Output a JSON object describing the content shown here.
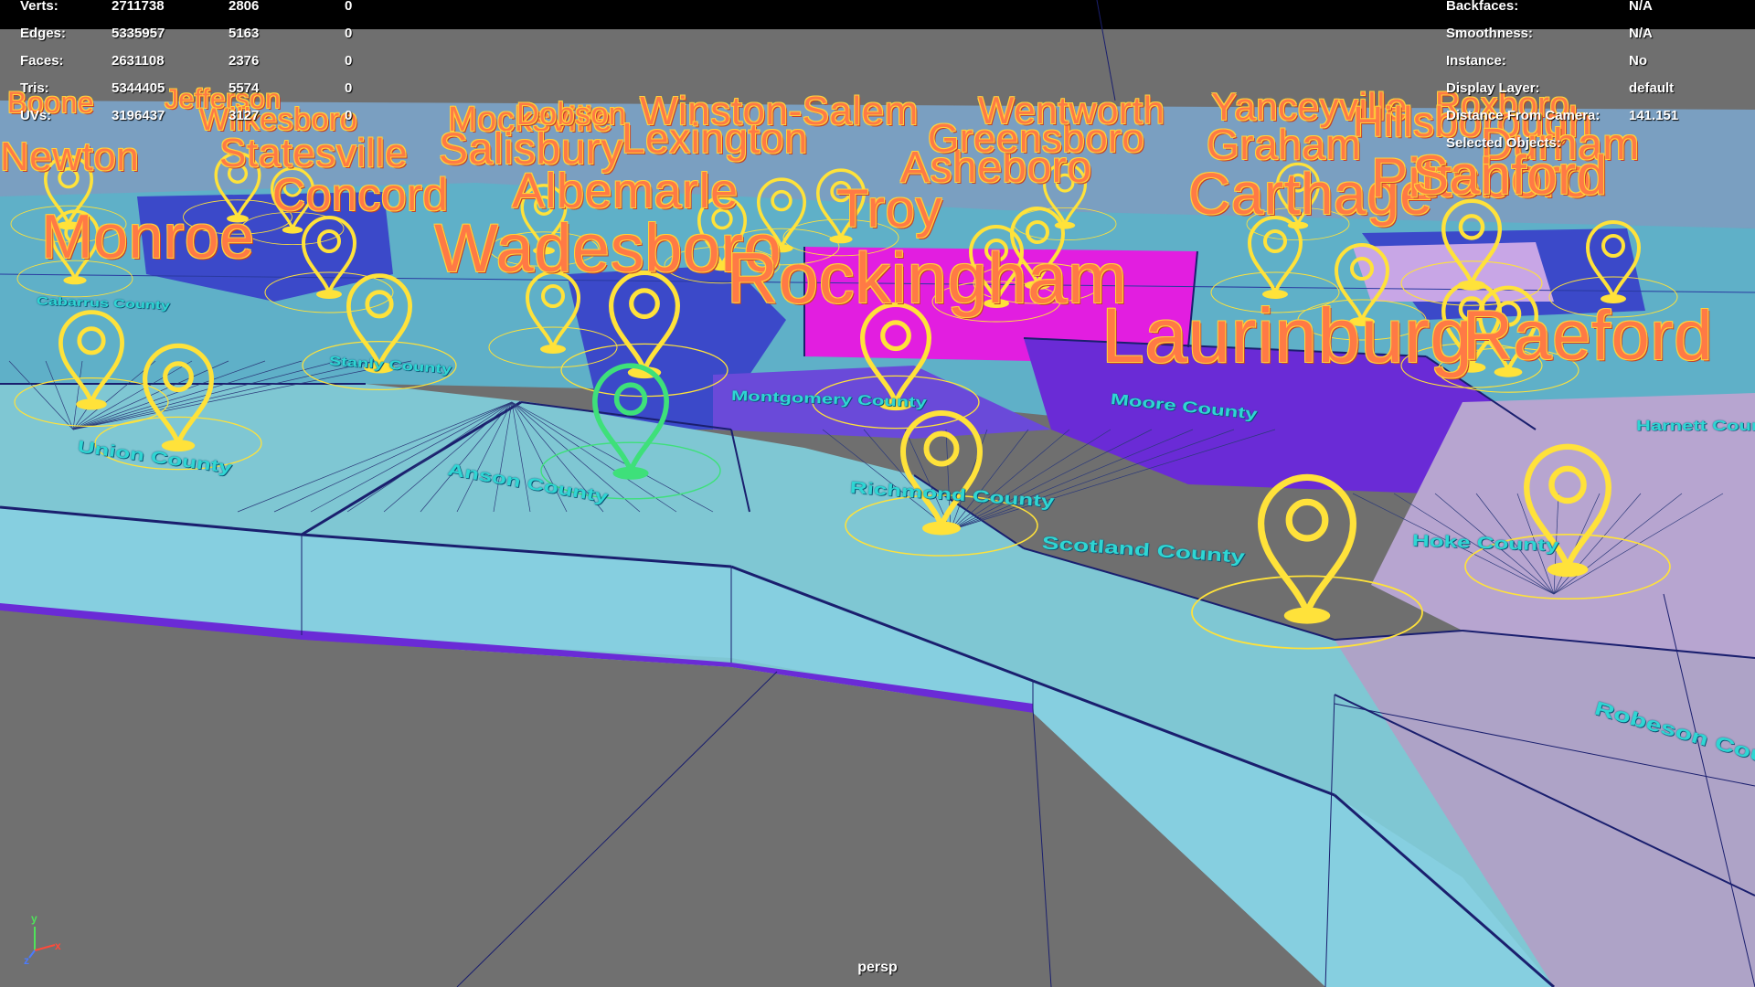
{
  "stats_left": [
    {
      "label": "Verts:",
      "v1": "2711738",
      "v2": "2806",
      "v3": "0"
    },
    {
      "label": "Edges:",
      "v1": "5335957",
      "v2": "5163",
      "v3": "0"
    },
    {
      "label": "Faces:",
      "v1": "2631108",
      "v2": "2376",
      "v3": "0"
    },
    {
      "label": "Tris:",
      "v1": "5344405",
      "v2": "5574",
      "v3": "0"
    },
    {
      "label": "UVs:",
      "v1": "3196437",
      "v2": "3127",
      "v3": "0"
    }
  ],
  "stats_right": [
    {
      "label": "Backfaces:",
      "value": "N/A"
    },
    {
      "label": "Smoothness:",
      "value": "N/A"
    },
    {
      "label": "Instance:",
      "value": "No"
    },
    {
      "label": "Display Layer:",
      "value": "default"
    },
    {
      "label": "Distance From Camera:",
      "value": "141.151"
    },
    {
      "label": "Selected Objects:",
      "value": ""
    }
  ],
  "camera_label": "persp",
  "axes": {
    "y": "y",
    "x": "x",
    "z": "z"
  },
  "cities": [
    {
      "name": "Boone"
    },
    {
      "name": "Jefferson"
    },
    {
      "name": "Wilkesboro"
    },
    {
      "name": "Mocksville"
    },
    {
      "name": "Dobson"
    },
    {
      "name": "Winston-Salem"
    },
    {
      "name": "Lexington"
    },
    {
      "name": "Newton"
    },
    {
      "name": "Statesville"
    },
    {
      "name": "Salisbury"
    },
    {
      "name": "Concord"
    },
    {
      "name": "Albemarle"
    },
    {
      "name": "Monroe"
    },
    {
      "name": "Wadesboro"
    },
    {
      "name": "Troy"
    },
    {
      "name": "Rockingham"
    },
    {
      "name": "Asheboro"
    },
    {
      "name": "Greensboro"
    },
    {
      "name": "Wentworth"
    },
    {
      "name": "Yanceyville"
    },
    {
      "name": "Roxboro"
    },
    {
      "name": "Graham"
    },
    {
      "name": "Hillsborough"
    },
    {
      "name": "Durham"
    },
    {
      "name": "Carthage"
    },
    {
      "name": "Pittsboro"
    },
    {
      "name": "Sanford"
    },
    {
      "name": "Laurinburg"
    },
    {
      "name": "Raeford"
    }
  ],
  "counties": [
    {
      "name": "Union County"
    },
    {
      "name": "Anson County"
    },
    {
      "name": "Richmond County"
    },
    {
      "name": "Montgomery County"
    },
    {
      "name": "Moore County"
    },
    {
      "name": "Scotland County"
    },
    {
      "name": "Hoke County"
    },
    {
      "name": "Robeson County"
    },
    {
      "name": "Stanly County"
    },
    {
      "name": "Cabarrus County"
    },
    {
      "name": "Harnett County"
    }
  ],
  "colors": {
    "background": "#6f6f6f",
    "ground_cyan": "#7fc7d3",
    "wall_cyan": "#86cfe0",
    "magenta": "#e21ee0",
    "purple": "#6a2bd6",
    "blue": "#3b49c9",
    "edge_dark": "#1a1f6e",
    "marker": "#ffe23a",
    "city_label": "#ff7a45",
    "county_label": "#2fd6d3"
  }
}
